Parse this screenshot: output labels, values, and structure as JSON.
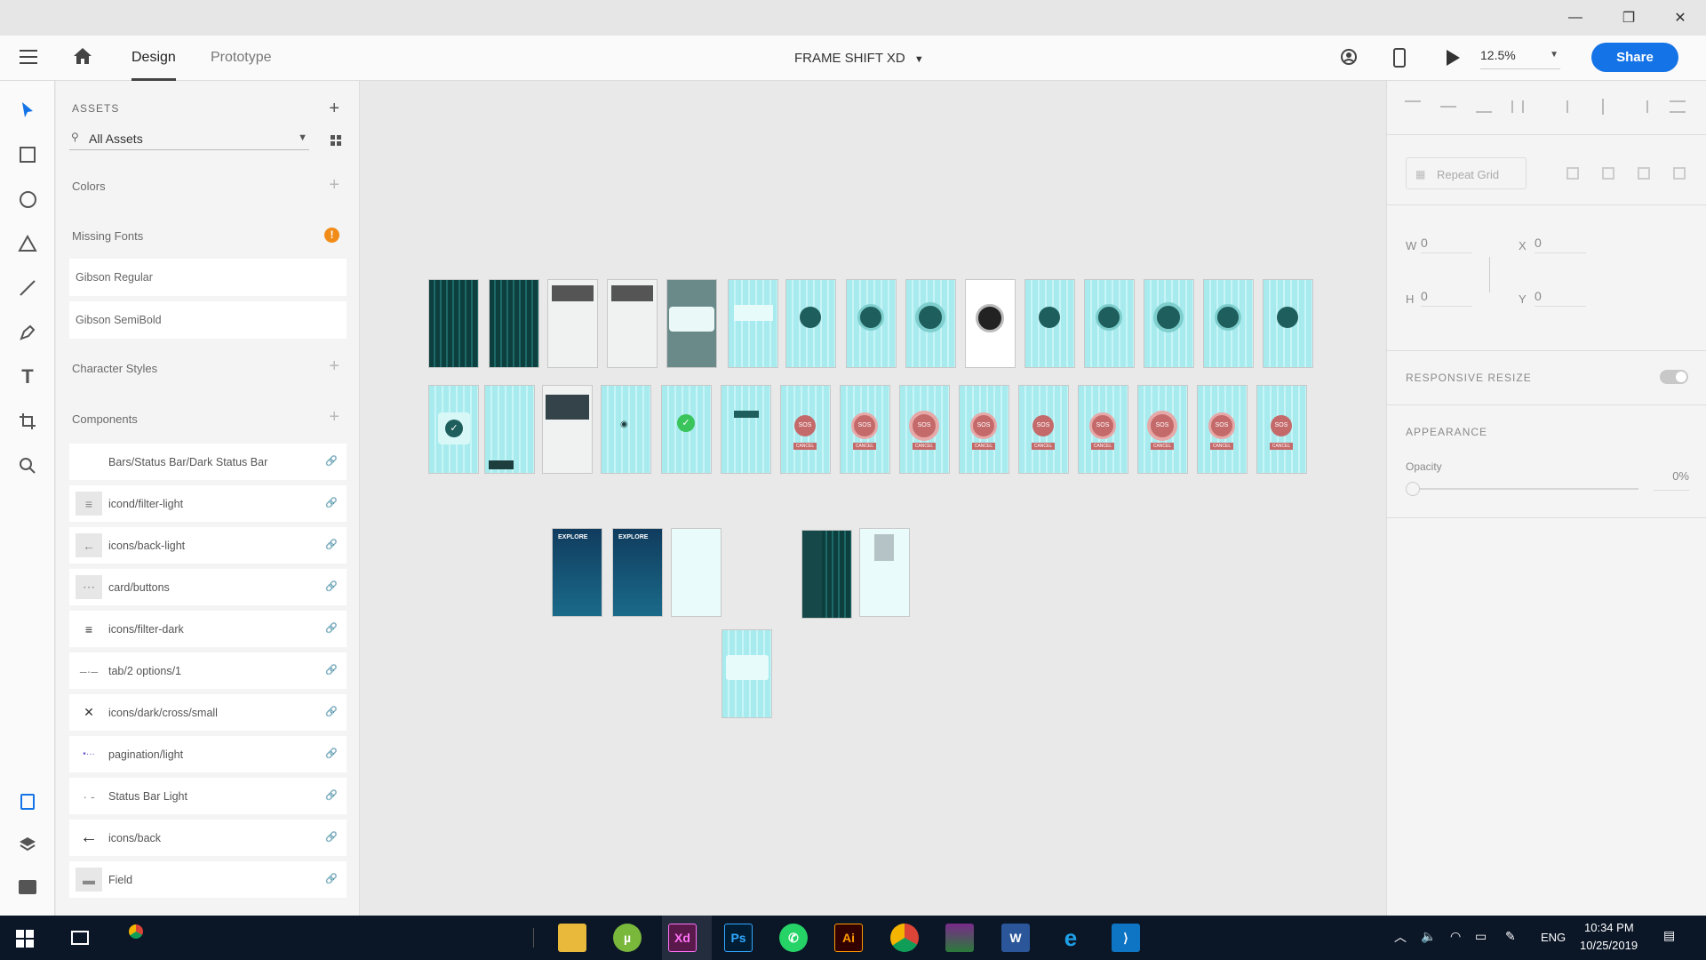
{
  "window": {
    "minimize": "—",
    "restore": "❐",
    "close": "✕"
  },
  "toolbar": {
    "tab_design": "Design",
    "tab_prototype": "Prototype",
    "doc_title": "FRAME SHIFT XD",
    "zoom": "12.5%",
    "share": "Share"
  },
  "assets": {
    "title": "ASSETS",
    "search_value": "All Assets",
    "colors": "Colors",
    "missing_fonts": "Missing Fonts",
    "fonts": [
      "Gibson Regular",
      "Gibson SemiBold"
    ],
    "character_styles": "Character Styles",
    "components": "Components",
    "component_items": [
      "Bars/Status Bar/Dark Status Bar",
      "icond/filter-light",
      "icons/back-light",
      "card/buttons",
      "icons/filter-dark",
      "tab/2 options/1",
      "icons/dark/cross/small",
      "pagination/light",
      "Status Bar Light",
      "icons/back",
      "Field"
    ]
  },
  "right": {
    "repeat_grid": "Repeat Grid",
    "w_label": "W",
    "w": "0",
    "x_label": "X",
    "x": "0",
    "h_label": "H",
    "h": "0",
    "y_label": "Y",
    "y": "0",
    "responsive_resize": "RESPONSIVE RESIZE",
    "appearance": "APPEARANCE",
    "opacity_label": "Opacity",
    "opacity": "0%"
  },
  "taskbar": {
    "lang": "ENG",
    "time": "10:34 PM",
    "date": "10/25/2019",
    "apps": [
      "Xd",
      "Ps",
      "Ai"
    ]
  },
  "canvas": {
    "artboard_label": "•••",
    "sos": "SOS",
    "cancel": "CANCEL",
    "explore": "EXPLORE"
  },
  "colors": {
    "accent": "#1473e6",
    "artboard_teal": "#a8ebee",
    "dark_teal": "#0d3f3f",
    "sos_red": "#c56a6a"
  }
}
